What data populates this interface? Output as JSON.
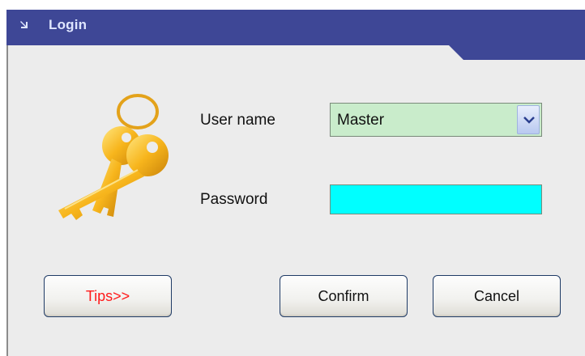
{
  "window": {
    "title": "Login",
    "title_bar_color": "#3e4796"
  },
  "form": {
    "username_label": "User name",
    "username_value": "Master",
    "password_label": "Password",
    "password_value": "",
    "password_field_color": "#00ffff",
    "username_field_color": "#c9eccb"
  },
  "buttons": {
    "tips": "Tips>>",
    "confirm": "Confirm",
    "cancel": "Cancel"
  },
  "icons": {
    "title": "collapse-arrow-icon",
    "keys": "keys-icon",
    "dropdown": "chevron-down-icon"
  }
}
